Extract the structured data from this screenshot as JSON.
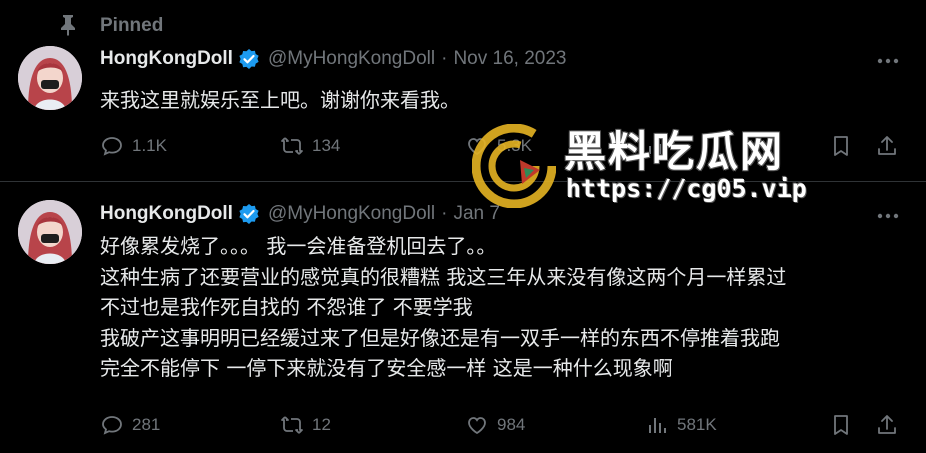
{
  "pinned": {
    "label": "Pinned"
  },
  "tweets": [
    {
      "display_name": "HongKongDoll",
      "handle": "@MyHongKongDoll",
      "separator": "·",
      "date": "Nov 16, 2023",
      "lines": [
        "来我这里就娱乐至上吧。谢谢你来看我。"
      ],
      "replies": "1.1K",
      "reposts": "134",
      "likes": "5.3K",
      "views": "",
      "verified": true
    },
    {
      "display_name": "HongKongDoll",
      "handle": "@MyHongKongDoll",
      "separator": "·",
      "date": "Jan 7",
      "lines": [
        "好像累发烧了。。。 我一会准备登机回去了。。",
        "这种生病了还要营业的感觉真的很糟糕 我这三年从来没有像这两个月一样累过",
        "不过也是我作死自找的 不怨谁了 不要学我",
        "我破产这事明明已经缓过来了但是好像还是有一双手一样的东西不停推着我跑",
        "完全不能停下 一停下来就没有了安全感一样 这是一种什么现象啊"
      ],
      "replies": "281",
      "reposts": "12",
      "likes": "984",
      "views": "581K",
      "verified": true
    }
  ],
  "watermark": {
    "title": "黑料吃瓜网",
    "url": "https://cg05.vip"
  },
  "colors": {
    "background": "#000000",
    "primary_text": "#e7e9ea",
    "secondary_text": "#71767b",
    "verified_blue": "#1d9bf0",
    "divider": "#2f3336",
    "watermark_gold": "#e6b422"
  },
  "icons": {
    "pin": "pin-icon",
    "verified": "verified-badge-icon",
    "more": "more-icon",
    "reply": "reply-icon",
    "repost": "repost-icon",
    "like": "heart-icon",
    "views": "views-icon",
    "bookmark": "bookmark-icon",
    "share": "share-icon"
  }
}
